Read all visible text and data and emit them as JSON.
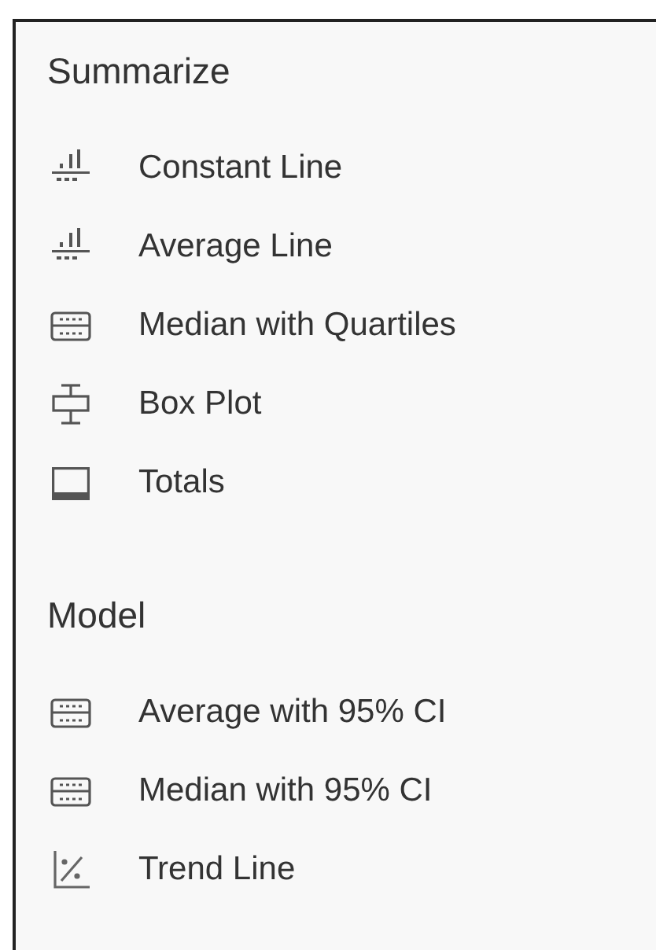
{
  "sections": [
    {
      "title": "Summarize",
      "items": [
        {
          "label": "Constant Line",
          "kind": "reference"
        },
        {
          "label": "Average Line",
          "kind": "reference"
        },
        {
          "label": "Median with Quartiles",
          "kind": "band"
        },
        {
          "label": "Box Plot",
          "kind": "boxplot"
        },
        {
          "label": "Totals",
          "kind": "totals"
        }
      ]
    },
    {
      "title": "Model",
      "items": [
        {
          "label": "Average with 95% CI",
          "kind": "band"
        },
        {
          "label": "Median with 95% CI",
          "kind": "band"
        },
        {
          "label": "Trend Line",
          "kind": "trend"
        }
      ]
    }
  ]
}
